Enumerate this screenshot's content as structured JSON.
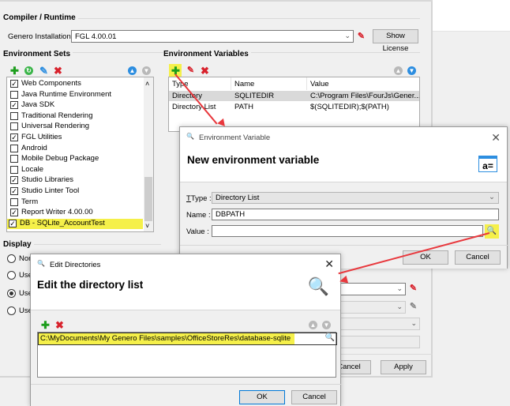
{
  "compiler": {
    "group_title": "Compiler / Runtime",
    "installation_label": "Genero Installation :",
    "installation_value": "FGL 4.00.01",
    "show_license_label": "Show License"
  },
  "env_sets": {
    "group_title": "Environment Sets",
    "items": [
      {
        "label": "Web Components",
        "checked": true
      },
      {
        "label": "Java Runtime Environment",
        "checked": false
      },
      {
        "label": "Java SDK",
        "checked": true
      },
      {
        "label": "Traditional Rendering",
        "checked": false
      },
      {
        "label": "Universal Rendering",
        "checked": false
      },
      {
        "label": "FGL Utilities",
        "checked": true
      },
      {
        "label": "Android",
        "checked": false
      },
      {
        "label": "Mobile Debug Package",
        "checked": false
      },
      {
        "label": "Locale",
        "checked": false
      },
      {
        "label": "Studio Libraries",
        "checked": true
      },
      {
        "label": "Studio Linter Tool",
        "checked": true
      },
      {
        "label": "Term",
        "checked": false
      },
      {
        "label": "Report Writer 4.00.00",
        "checked": true
      },
      {
        "label": "DB - SQLite_AccountTest",
        "checked": true,
        "highlighted": true
      }
    ]
  },
  "env_vars": {
    "group_title": "Environment Variables",
    "columns": [
      "Type",
      "Name",
      "Value"
    ],
    "rows": [
      {
        "type": "Directory",
        "name": "SQLITEDIR",
        "value": "C:\\Program Files\\FourJs\\Gener...",
        "selected": true
      },
      {
        "type": "Directory List",
        "name": "PATH",
        "value": "$(SQLITEDIR);$(PATH)",
        "selected": false
      }
    ]
  },
  "display": {
    "group_title": "Display",
    "options": [
      {
        "label": "Non",
        "selected": false
      },
      {
        "label": "Use",
        "selected": false
      },
      {
        "label": "Use",
        "selected": true
      },
      {
        "label": "Use",
        "selected": false
      }
    ]
  },
  "main_buttons": {
    "cancel": "Cancel",
    "apply": "Apply"
  },
  "env_var_dialog": {
    "window_title": "Environment Variable",
    "header": "New environment variable",
    "type_label": "Type :",
    "type_value": "Directory List",
    "name_label": "Name :",
    "name_value": "DBPATH",
    "value_label": "Value :",
    "value_value": "",
    "ok": "OK",
    "cancel": "Cancel"
  },
  "edit_dirs_dialog": {
    "window_title": "Edit Directories",
    "header": "Edit the directory list",
    "entries": [
      "C:\\MyDocuments\\My Genero Files\\samples\\OfficeStoreRes\\database-sqlite"
    ],
    "ok": "OK",
    "cancel": "Cancel"
  },
  "icons": {
    "add": "✚",
    "delete": "✖",
    "edit": "✎",
    "up": "▲",
    "down": "▼",
    "check": "✓",
    "close": "✕",
    "search": "🔍",
    "chevron": "⌄",
    "scroll_up": "˄",
    "scroll_down": "˅"
  },
  "colors": {
    "highlight": "#f5f04a",
    "annotation_arrow": "#e8383d",
    "accent_blue": "#2d8ee0"
  }
}
